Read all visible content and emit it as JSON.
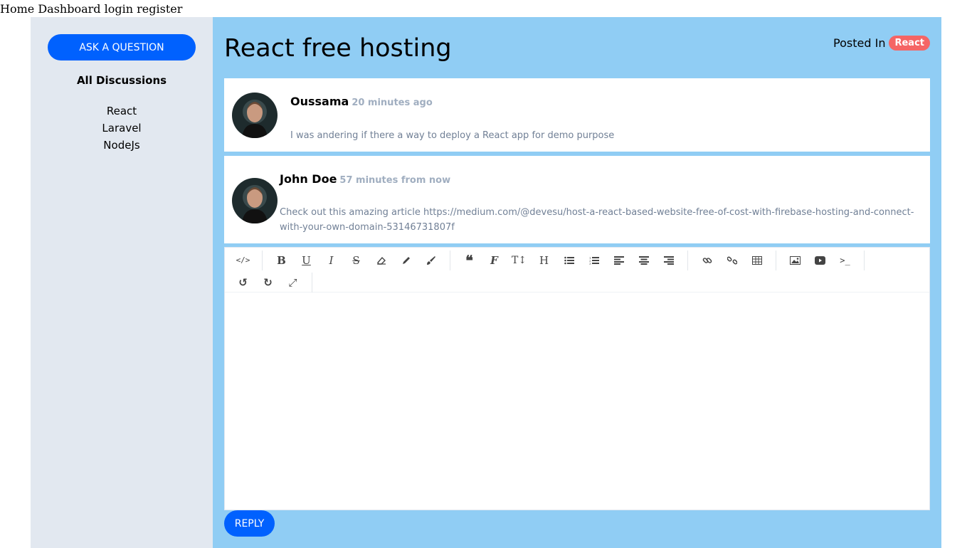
{
  "nav": {
    "home": "Home",
    "dashboard": "Dashboard",
    "login": "login",
    "register": "register"
  },
  "sidebar": {
    "ask_button": "ASK A QUESTION",
    "heading": "All Discussions",
    "categories": [
      "React",
      "Laravel",
      "NodeJs"
    ]
  },
  "discussion": {
    "title": "React free hosting",
    "posted_in_label": "Posted In",
    "category_badge": "React"
  },
  "comments": [
    {
      "author": "Oussama",
      "time": "20 minutes ago",
      "body": "I was andering if there a way to deploy a React app for demo purpose"
    },
    {
      "author": "John Doe",
      "time": "57 minutes from now",
      "body": "Check out this amazing article https://medium.com/@devesu/host-a-react-based-website-free-of-cost-with-firebase-hosting-and-connect-with-your-own-domain-53146731807f"
    }
  ],
  "editor": {
    "toolbar_icons": [
      "code-view-icon",
      "bold-icon",
      "underline-icon",
      "italic-icon",
      "strikethrough-icon",
      "eraser-icon",
      "pencil-icon",
      "brush-icon",
      "blockquote-icon",
      "font-icon",
      "font-size-icon",
      "heading-icon",
      "bullet-list-icon",
      "numbered-list-icon",
      "align-left-icon",
      "align-center-icon",
      "align-right-icon",
      "link-icon",
      "unlink-icon",
      "table-icon",
      "image-icon",
      "video-icon",
      "terminal-icon",
      "undo-icon",
      "redo-icon",
      "fullscreen-icon"
    ]
  },
  "reply_button": "REPLY",
  "colors": {
    "primary_button": "#0061fe",
    "sidebar_bg": "#e2e8f0",
    "main_bg": "#90cdf4",
    "badge_bg": "#f56565",
    "time_text": "#a0aec0",
    "body_text": "#718096"
  }
}
